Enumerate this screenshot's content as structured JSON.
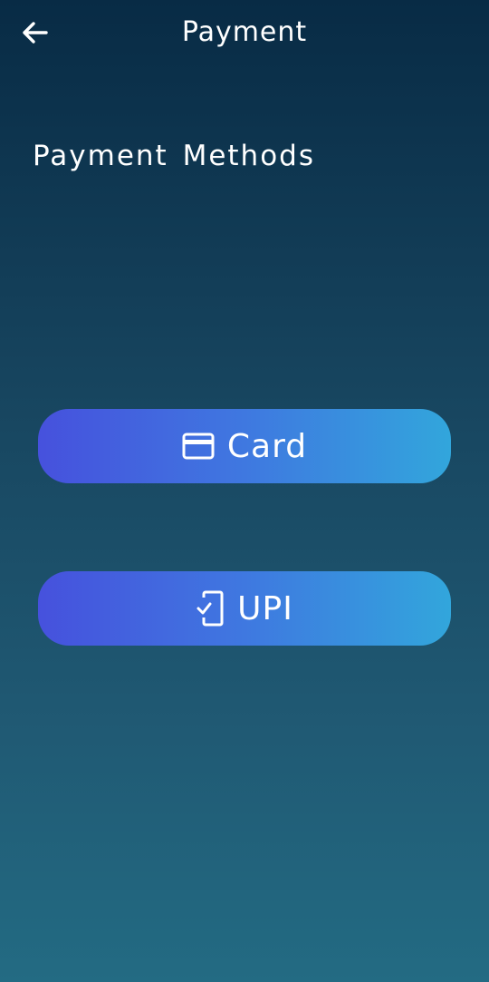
{
  "app_bar": {
    "back_icon": "arrow-left-icon",
    "title": "Payment"
  },
  "section": {
    "title": "Payment Methods"
  },
  "methods": [
    {
      "label": "Card",
      "icon": "credit-card-icon"
    },
    {
      "label": "UPI",
      "icon": "mobile-check-icon"
    }
  ],
  "colors": {
    "background_top": "#082b45",
    "background_bottom": "#236b83",
    "button_gradient_start": "#4651dd",
    "button_gradient_end": "#32a6dc",
    "text": "#ffffff"
  }
}
